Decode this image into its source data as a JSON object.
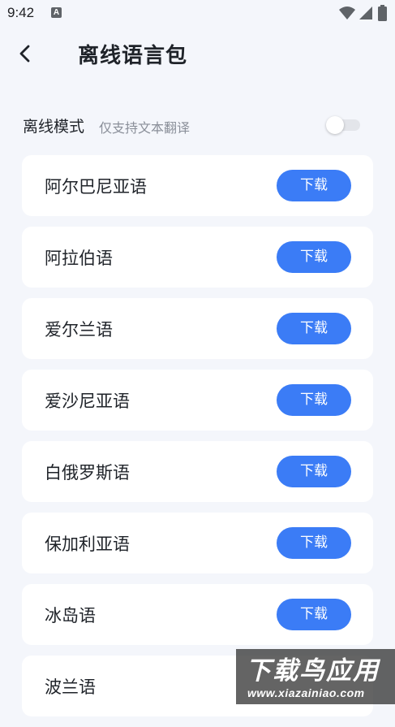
{
  "status_bar": {
    "time": "9:42",
    "notification_icon": "a-icon",
    "icons": [
      "wifi-icon",
      "signal-icon",
      "battery-icon"
    ]
  },
  "header": {
    "back_icon": "chevron-left-icon",
    "title": "离线语言包"
  },
  "offline_mode": {
    "label": "离线模式",
    "subtitle": "仅支持文本翻译",
    "enabled": false
  },
  "languages": [
    {
      "name": "阿尔巴尼亚语",
      "action": "下载"
    },
    {
      "name": "阿拉伯语",
      "action": "下载"
    },
    {
      "name": "爱尔兰语",
      "action": "下载"
    },
    {
      "name": "爱沙尼亚语",
      "action": "下载"
    },
    {
      "name": "白俄罗斯语",
      "action": "下载"
    },
    {
      "name": "保加利亚语",
      "action": "下载"
    },
    {
      "name": "冰岛语",
      "action": "下载"
    },
    {
      "name": "波兰语",
      "action": ""
    }
  ],
  "watermark": {
    "logo_text": "下载鸟应用",
    "url": "www.xiazainiao.com"
  },
  "colors": {
    "background": "#f4f6fb",
    "card": "#ffffff",
    "accent": "#3b7cf6",
    "text_primary": "#1f2329",
    "text_secondary": "#8a8f99"
  }
}
